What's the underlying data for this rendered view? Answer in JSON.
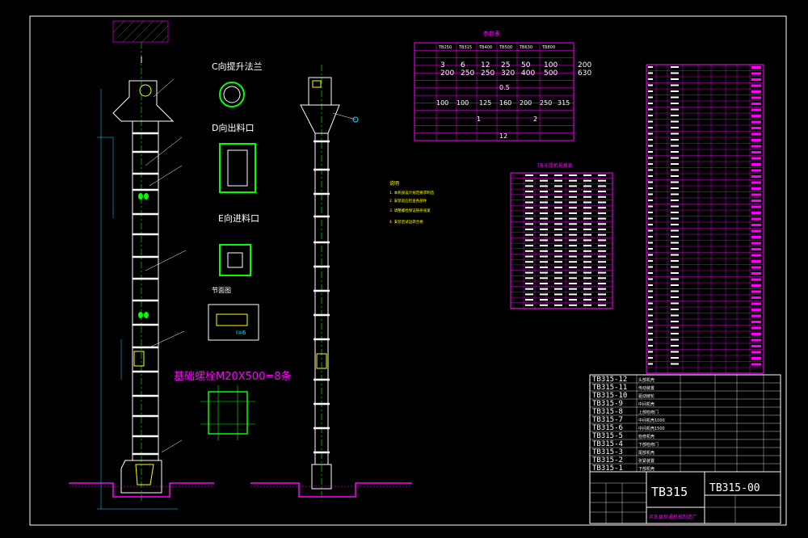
{
  "views": {
    "c_label": "C向提升法兰",
    "d_label": "D向出料口",
    "e_label": "E向进料口",
    "small_label": "节面图",
    "anchor_label": "基础螺栓M20X500=8条",
    "k_note": "I=6"
  },
  "param_table": {
    "title": "参数表",
    "headers": [
      "",
      "TB250",
      "TB315",
      "TB400",
      "TB500",
      "TB630",
      "TB800"
    ],
    "rows": [
      [
        "",
        "3",
        "6",
        "12",
        "25",
        "50",
        "100",
        "200"
      ],
      [
        "",
        "200",
        "250",
        "250",
        "320",
        "400",
        "500",
        "630"
      ]
    ],
    "mid_values": [
      "0.5",
      "100",
      "100",
      "125",
      "160",
      "200",
      "250",
      "315",
      "1",
      "2",
      "12"
    ]
  },
  "tb_table": {
    "title": "TB斗提机规格表"
  },
  "notes": {
    "title": "说明",
    "lines": [
      "1. 本机按设计规范要求制造",
      "2. 安装前应检查各部件",
      "3. 调整螺栓保证链条张紧",
      "4. 安装后试运转合格"
    ]
  },
  "parts": [
    {
      "code": "TB315-12",
      "name": "头部机壳"
    },
    {
      "code": "TB315-11",
      "name": "传动装置"
    },
    {
      "code": "TB315-10",
      "name": "驱动链轮"
    },
    {
      "code": "TB315-9",
      "name": "中间机壳"
    },
    {
      "code": "TB315-8",
      "name": "上部检修门"
    },
    {
      "code": "TB315-7",
      "name": "中间机壳1000"
    },
    {
      "code": "TB315-6",
      "name": "中间机壳1500"
    },
    {
      "code": "TB315-5",
      "name": "检修机壳"
    },
    {
      "code": "TB315-4",
      "name": "下部检修门"
    },
    {
      "code": "TB315-3",
      "name": "尾部机壳"
    },
    {
      "code": "TB315-2",
      "name": "张紧装置"
    },
    {
      "code": "TB315-1",
      "name": "下部机壳"
    }
  ],
  "title_block": {
    "model": "TB315",
    "drawing_no": "TB315-00",
    "company": "卢氏县恒通机械制造厂"
  },
  "colors": {
    "outline": "#ffffff",
    "dim": "#00e5ff",
    "table": "#ff00ff",
    "green": "#00ff00",
    "yellow": "#ffff00",
    "centerline": "#00ff00"
  }
}
